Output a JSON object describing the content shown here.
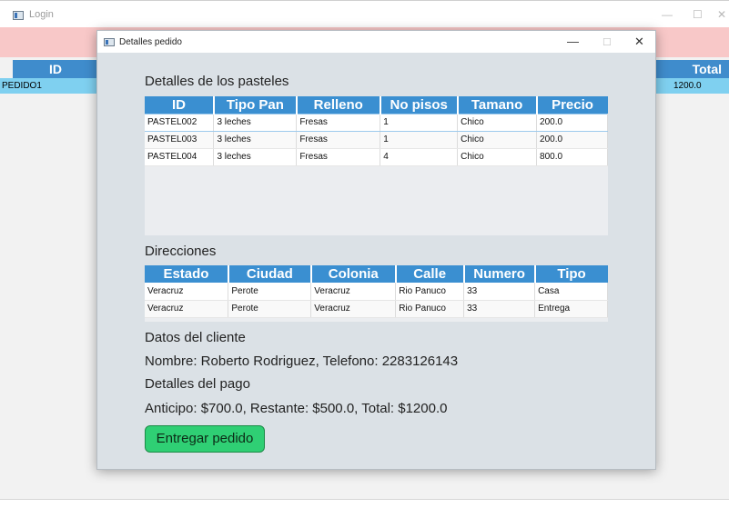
{
  "background_window": {
    "title": "Login",
    "controls": {
      "minimize": "—",
      "maximize": "☐",
      "close": "✕"
    },
    "table_headers": {
      "left": "ID",
      "right": "Total"
    },
    "row": {
      "id": "PEDIDO1",
      "total": "1200.0"
    }
  },
  "dialog": {
    "title": "Detalles pedido",
    "controls": {
      "minimize": "—",
      "maximize": "☐",
      "close": "✕"
    }
  },
  "pasteles": {
    "label": "Detalles de los pasteles",
    "columns": [
      "ID",
      "Tipo Pan",
      "Relleno",
      "No pisos",
      "Tamano",
      "Precio"
    ],
    "rows": [
      [
        "PASTEL002",
        "3 leches",
        "Fresas",
        "1",
        "Chico",
        "200.0"
      ],
      [
        "PASTEL003",
        "3 leches",
        "Fresas",
        "1",
        "Chico",
        "200.0"
      ],
      [
        "PASTEL004",
        "3 leches",
        "Fresas",
        "4",
        "Chico",
        "800.0"
      ]
    ]
  },
  "direcciones": {
    "label": "Direcciones",
    "columns": [
      "Estado",
      "Ciudad",
      "Colonia",
      "Calle",
      "Numero",
      "Tipo"
    ],
    "rows": [
      [
        "Veracruz",
        "Perote",
        "Veracruz",
        "Rio Panuco",
        "33",
        "Casa"
      ],
      [
        "Veracruz",
        "Perote",
        "Veracruz",
        "Rio Panuco",
        "33",
        "Entrega"
      ]
    ]
  },
  "cliente": {
    "label": "Datos del cliente",
    "text": "Nombre: Roberto Rodriguez, Telefono: 2283126143"
  },
  "pago": {
    "label": "Detalles del pago",
    "text": "Anticipo: $700.0, Restante: $500.0, Total: $1200.0"
  },
  "button": {
    "label": "Entregar pedido"
  },
  "colors": {
    "header_blue": "#3a8fd1",
    "button_green": "#2fcf74",
    "dialog_bg": "#dbe1e6",
    "pink_band": "#f8c8c8",
    "selected_row": "#7fd0f0"
  }
}
